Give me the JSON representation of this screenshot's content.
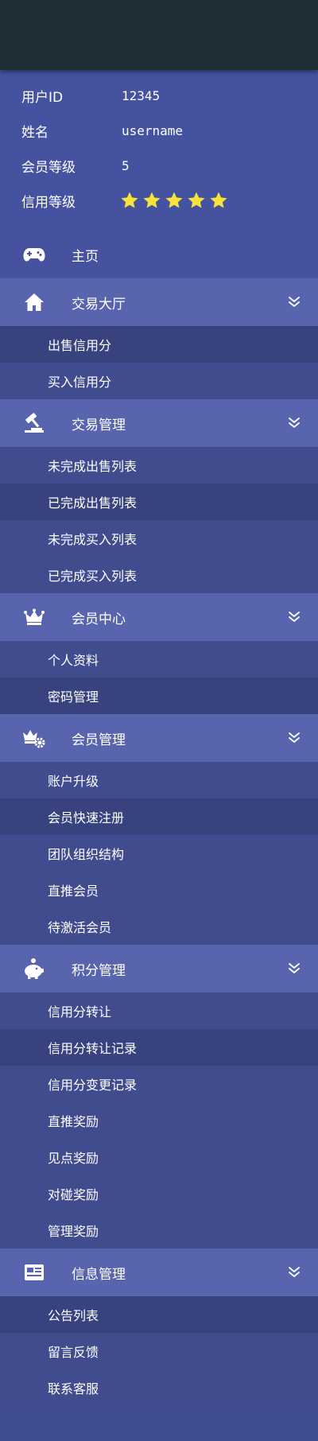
{
  "profile": {
    "user_id_label": "用户ID",
    "user_id_value": "12345",
    "name_label": "姓名",
    "name_value": "username",
    "member_level_label": "会员等级",
    "member_level_value": "5",
    "credit_level_label": "信用等级",
    "credit_stars": 5
  },
  "menu": {
    "home": {
      "label": "主页",
      "icon": "gamepad-icon"
    },
    "trading_hall": {
      "label": "交易大厅",
      "icon": "home-icon",
      "items": [
        "出售信用分",
        "买入信用分"
      ]
    },
    "trade_management": {
      "label": "交易管理",
      "icon": "gavel-icon",
      "items": [
        "未完成出售列表",
        "已完成出售列表",
        "未完成买入列表",
        "已完成买入列表"
      ]
    },
    "member_center": {
      "label": "会员中心",
      "icon": "crown-icon",
      "items": [
        "个人资料",
        "密码管理"
      ]
    },
    "member_management": {
      "label": "会员管理",
      "icon": "crown-gear-icon",
      "items": [
        "账户升级",
        "会员快速注册",
        "团队组织结构",
        "直推会员",
        "待激活会员"
      ]
    },
    "points_management": {
      "label": "积分管理",
      "icon": "piggy-bank-icon",
      "items": [
        "信用分转让",
        "信用分转让记录",
        "信用分变更记录",
        "直推奖励",
        "见点奖励",
        "对碰奖励",
        "管理奖励"
      ]
    },
    "info_management": {
      "label": "信息管理",
      "icon": "newspaper-icon",
      "items": [
        "公告列表",
        "留言反馈",
        "联系客服"
      ]
    }
  },
  "colors": {
    "topbar": "#1e2e35",
    "profile_bg": "#4552a0",
    "section_bg": "#5864ad",
    "sub_bg": "#414c8f",
    "sub_dark_bg": "#37427e",
    "star": "#f7e23a"
  }
}
